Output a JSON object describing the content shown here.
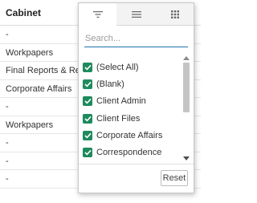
{
  "grid": {
    "column_title": "Cabinet",
    "rows": [
      "-",
      "Workpapers",
      "Final Reports & Retu",
      "Corporate Affairs",
      "-",
      "Workpapers",
      "-",
      "-",
      "-"
    ]
  },
  "filter_popup": {
    "tabs": [
      {
        "name": "filter",
        "icon": "filter-icon",
        "active": true
      },
      {
        "name": "general",
        "icon": "menu-icon",
        "active": false
      },
      {
        "name": "columns",
        "icon": "columns-grid-icon",
        "active": false
      }
    ],
    "search": {
      "placeholder": "Search...",
      "value": ""
    },
    "items": [
      {
        "label": "(Select All)",
        "checked": true
      },
      {
        "label": "(Blank)",
        "checked": true
      },
      {
        "label": "Client Admin",
        "checked": true
      },
      {
        "label": "Client Files",
        "checked": true
      },
      {
        "label": "Corporate Affairs",
        "checked": true
      },
      {
        "label": "Correspondence",
        "checked": true
      }
    ],
    "reset_label": "Reset"
  },
  "colors": {
    "checkbox": "#1e8a5e",
    "search_underline": "#1a73a8"
  }
}
